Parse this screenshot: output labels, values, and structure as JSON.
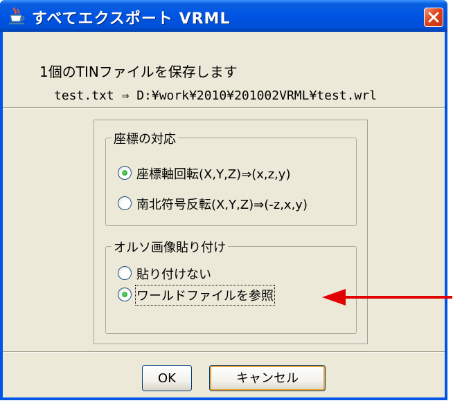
{
  "window": {
    "title": "すべてエクスポート VRML",
    "app_icon": "java-coffee-cup-icon",
    "close_icon": "close-x-icon"
  },
  "message": {
    "line1": "1個のTINファイルを保存します",
    "line2": "test.txt ⇒ D:¥work¥2010¥201002VRML¥test.wrl"
  },
  "coordinate_group": {
    "legend": "座標の対応",
    "options": [
      {
        "label": "座標軸回転(X,Y,Z)⇒(x,z,y)",
        "selected": true
      },
      {
        "label": "南北符号反転(X,Y,Z)⇒(-z,x,y)",
        "selected": false
      }
    ]
  },
  "ortho_group": {
    "legend": "オルソ画像貼り付け",
    "options": [
      {
        "label": "貼り付けない",
        "selected": false
      },
      {
        "label": "ワールドファイルを参照",
        "selected": true
      }
    ]
  },
  "buttons": {
    "ok": "OK",
    "cancel": "キャンセル"
  },
  "colors": {
    "title_bar": "#0054e3",
    "dialog_bg": "#ece9d8",
    "close_button": "#e0441c",
    "annotation_arrow": "#e00000",
    "radio_selected": "#21a121"
  }
}
